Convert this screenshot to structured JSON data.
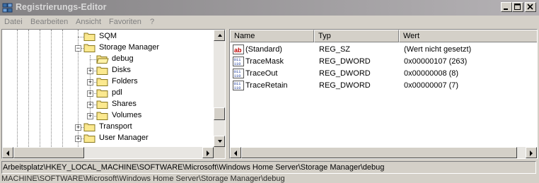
{
  "window": {
    "title": "Registrierungs-Editor"
  },
  "menu": [
    "Datei",
    "Bearbeiten",
    "Ansicht",
    "Favoriten",
    "?"
  ],
  "tree": [
    {
      "label": "SQM",
      "level": 0,
      "expander": "none",
      "open": false
    },
    {
      "label": "Storage Manager",
      "level": 0,
      "expander": "minus",
      "open": false
    },
    {
      "label": "debug",
      "level": 1,
      "expander": "none",
      "open": true
    },
    {
      "label": "Disks",
      "level": 1,
      "expander": "plus",
      "open": false
    },
    {
      "label": "Folders",
      "level": 1,
      "expander": "plus",
      "open": false
    },
    {
      "label": "pdl",
      "level": 1,
      "expander": "plus",
      "open": false
    },
    {
      "label": "Shares",
      "level": 1,
      "expander": "plus",
      "open": false
    },
    {
      "label": "Volumes",
      "level": 1,
      "expander": "plus",
      "open": false
    },
    {
      "label": "Transport",
      "level": 0,
      "expander": "plus",
      "open": false
    },
    {
      "label": "User Manager",
      "level": 0,
      "expander": "plus",
      "open": false
    }
  ],
  "list": {
    "columns": [
      "Name",
      "Typ",
      "Wert"
    ],
    "rows": [
      {
        "icon": "string-value-icon",
        "name": "(Standard)",
        "type": "REG_SZ",
        "value": "(Wert nicht gesetzt)"
      },
      {
        "icon": "dword-value-icon",
        "name": "TraceMask",
        "type": "REG_DWORD",
        "value": "0x00000107 (263)"
      },
      {
        "icon": "dword-value-icon",
        "name": "TraceOut",
        "type": "REG_DWORD",
        "value": "0x00000008 (8)"
      },
      {
        "icon": "dword-value-icon",
        "name": "TraceRetain",
        "type": "REG_DWORD",
        "value": "0x00000007 (7)"
      }
    ]
  },
  "status": {
    "path": "Arbeitsplatz\\HKEY_LOCAL_MACHINE\\SOFTWARE\\Microsoft\\Windows Home Server\\Storage Manager\\debug",
    "ghost": "MACHINE\\SOFTWARE\\Microsoft\\Windows Home Server\\Storage Manager\\debug"
  }
}
